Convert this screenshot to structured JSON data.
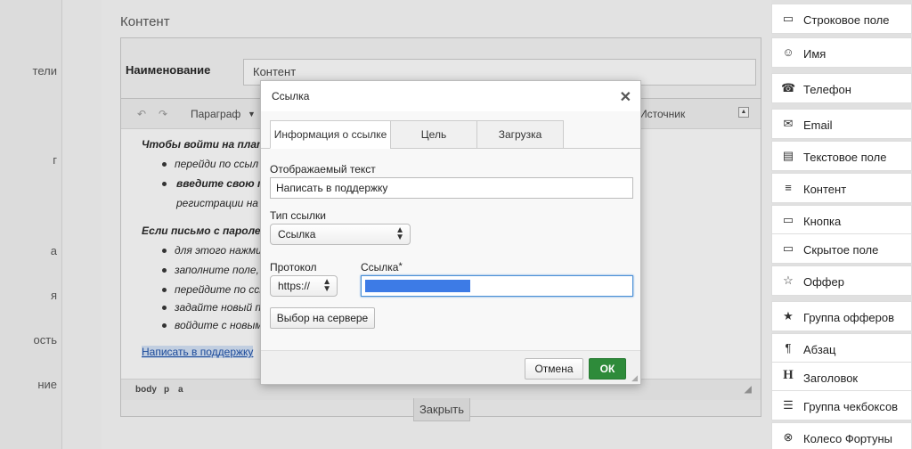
{
  "left_sidebar": {
    "fragments": [
      "тели",
      "г",
      "а",
      "я",
      "ость",
      "ние"
    ]
  },
  "editor": {
    "section_title": "Контент",
    "name_label": "Наименование",
    "name_value": "Контент",
    "toolbar": {
      "undo": "↶",
      "redo": "↷",
      "format": "Параграф",
      "source": "Источник"
    },
    "content": {
      "line1": "Чтобы войти на платф",
      "line2": "перейди по ссыл",
      "line3": "введите свою по",
      "line4": "регистрации на В",
      "line5": "Если письмо с пароле",
      "line6": "для этого нажми",
      "line7": "заполните поле,",
      "line8": "перейдите по ссы",
      "line9": "задайте новый па",
      "line10": "войдите с новым",
      "link_text": "Написать в поддержку"
    },
    "statusbar": [
      "body",
      "p",
      "a"
    ],
    "close_tab": "Закрыть"
  },
  "right_panel": {
    "items": [
      {
        "label": "Строковое поле",
        "icon": "▭"
      },
      {
        "label": "Имя",
        "icon": "☺"
      },
      {
        "label": "Телефон",
        "icon": "☎"
      },
      {
        "label": "Email",
        "icon": "✉"
      },
      {
        "label": "Текстовое поле",
        "icon": "▤"
      },
      {
        "label": "Контент",
        "icon": "≡"
      },
      {
        "label": "Кнопка",
        "icon": "▭"
      },
      {
        "label": "Скрытое поле",
        "icon": "▭"
      },
      {
        "label": "Оффер",
        "icon": "☆"
      },
      {
        "label": "Группа офферов",
        "icon": "★"
      },
      {
        "label": "Абзац",
        "icon": "¶"
      },
      {
        "label": "Заголовок",
        "icon": "H"
      },
      {
        "label": "Группа чекбоксов",
        "icon": "☰"
      },
      {
        "label": "Колесо Фортуны",
        "icon": "⊗"
      }
    ]
  },
  "modal": {
    "title": "Ссылка",
    "close": "✕",
    "tabs": [
      "Информация о ссылке",
      "Цель",
      "Загрузка"
    ],
    "display_text_label": "Отображаемый текст",
    "display_text_value": "Написать в поддержку",
    "link_type_label": "Тип ссылки",
    "link_type_value": "Ссылка",
    "protocol_label": "Протокол",
    "protocol_value": "https://",
    "url_label": "Ссылка",
    "url_required": "*",
    "server_browse": "Выбор на сервере",
    "cancel": "Отмена",
    "ok": "ОК"
  }
}
